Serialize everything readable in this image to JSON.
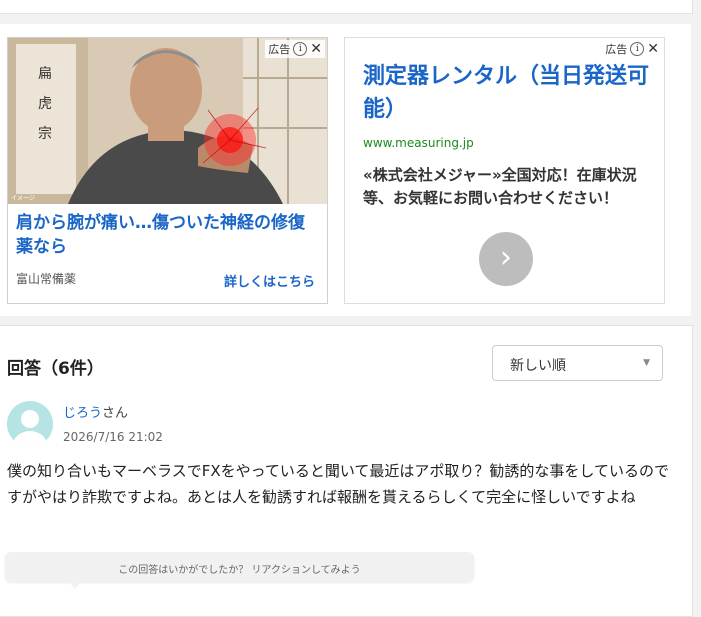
{
  "ads": {
    "left": {
      "tag": "広告",
      "image_caption": "イメージ",
      "title": "肩から腕が痛い…傷ついた神経の修復薬なら",
      "sponsor": "富山常備薬",
      "cta": "詳しくはこちら"
    },
    "right": {
      "tag": "広告",
      "title": "測定器レンタル（当日発送可能）",
      "url": "www.measuring.jp",
      "description": "«株式会社メジャー»全国対応！在庫状況等、お気軽にお問い合わせください！"
    }
  },
  "answers": {
    "title": "回答（6件）",
    "sort": {
      "selected": "新しい順"
    },
    "items": [
      {
        "user": "じろう",
        "honorific": "さん",
        "date": "2026/7/16 21:02",
        "body": "僕の知り合いもマーベラスでFXをやっていると聞いて最近はアポ取り？勧誘的な事をしているのですがやはり詐欺ですよね。あとは人を勧誘すれば報酬を貰えるらしくて完全に怪しいですよね",
        "reaction_prompt": "この回答はいかがでしたか？ リアクションしてみよう"
      }
    ]
  },
  "colors": {
    "link": "#1a66c8",
    "url_green": "#1c8a1c",
    "avatar_bg": "#b6e3e4"
  },
  "icons": [
    "ad-info-icon",
    "ad-close-icon",
    "next-arrow-icon",
    "dropdown-caret-icon",
    "user-avatar-icon"
  ]
}
